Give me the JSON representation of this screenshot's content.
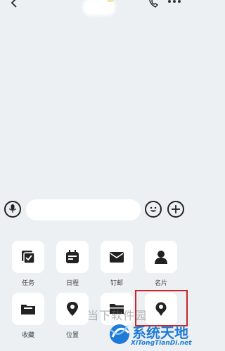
{
  "header": {
    "back_icon": "chevron-left-icon",
    "title": "",
    "call_icon": "phone-icon",
    "more_icon": "more-horizontal-icon"
  },
  "input_bar": {
    "voice_icon": "microphone-icon",
    "message_placeholder": "",
    "emoji_icon": "smile-icon",
    "plus_icon": "plus-icon"
  },
  "panel": {
    "items": [
      {
        "label": "任务",
        "icon": "task-checklist-icon"
      },
      {
        "label": "日程",
        "icon": "calendar-icon"
      },
      {
        "label": "钉邮",
        "icon": "mail-icon"
      },
      {
        "label": "名片",
        "icon": "contact-card-icon"
      },
      {
        "label": "收藏",
        "icon": "folder-favorite-icon"
      },
      {
        "label": "位置",
        "icon": "location-pin-icon"
      },
      {
        "label": "",
        "icon": "folder-icon"
      },
      {
        "label": "",
        "icon": "location-share-icon"
      }
    ]
  },
  "watermark": {
    "site_cn": "当下软件园",
    "brand": "系统天地",
    "url": "XiTongTianDi.net"
  },
  "colors": {
    "background": "#edf0f2",
    "tile": "#ffffff",
    "highlight": "#c7262a",
    "brand_blue": "#1f7bd6"
  }
}
